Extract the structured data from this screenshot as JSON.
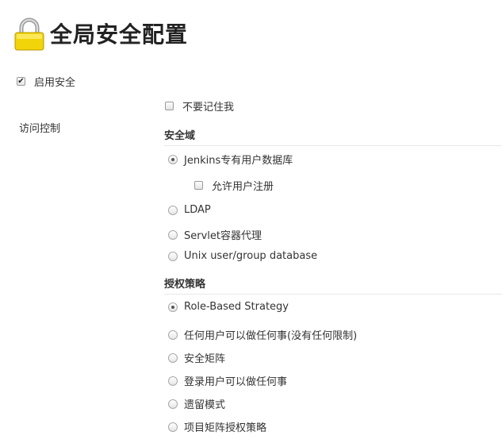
{
  "page_title": "全局安全配置",
  "icon": "lock-icon",
  "enable_security": {
    "label": "启用安全",
    "checked": true
  },
  "access_control": {
    "label": "访问控制",
    "dont_remember_me": {
      "label": "不要记住我",
      "checked": false
    }
  },
  "security_realm": {
    "title": "安全域",
    "options": [
      {
        "label": "Jenkins专有用户数据库",
        "checked": true
      },
      {
        "label": "LDAP",
        "checked": false
      },
      {
        "label": "Servlet容器代理",
        "checked": false
      },
      {
        "label": "Unix user/group database",
        "checked": false
      }
    ],
    "allow_signup": {
      "label": "允许用户注册",
      "checked": false
    }
  },
  "authorization": {
    "title": "授权策略",
    "options": [
      {
        "label": "Role-Based Strategy",
        "checked": true
      },
      {
        "label": "任何用户可以做任何事(没有任何限制)",
        "checked": false
      },
      {
        "label": "安全矩阵",
        "checked": false
      },
      {
        "label": "登录用户可以做任何事",
        "checked": false
      },
      {
        "label": "遗留模式",
        "checked": false
      },
      {
        "label": "项目矩阵授权策略",
        "checked": false
      }
    ]
  }
}
